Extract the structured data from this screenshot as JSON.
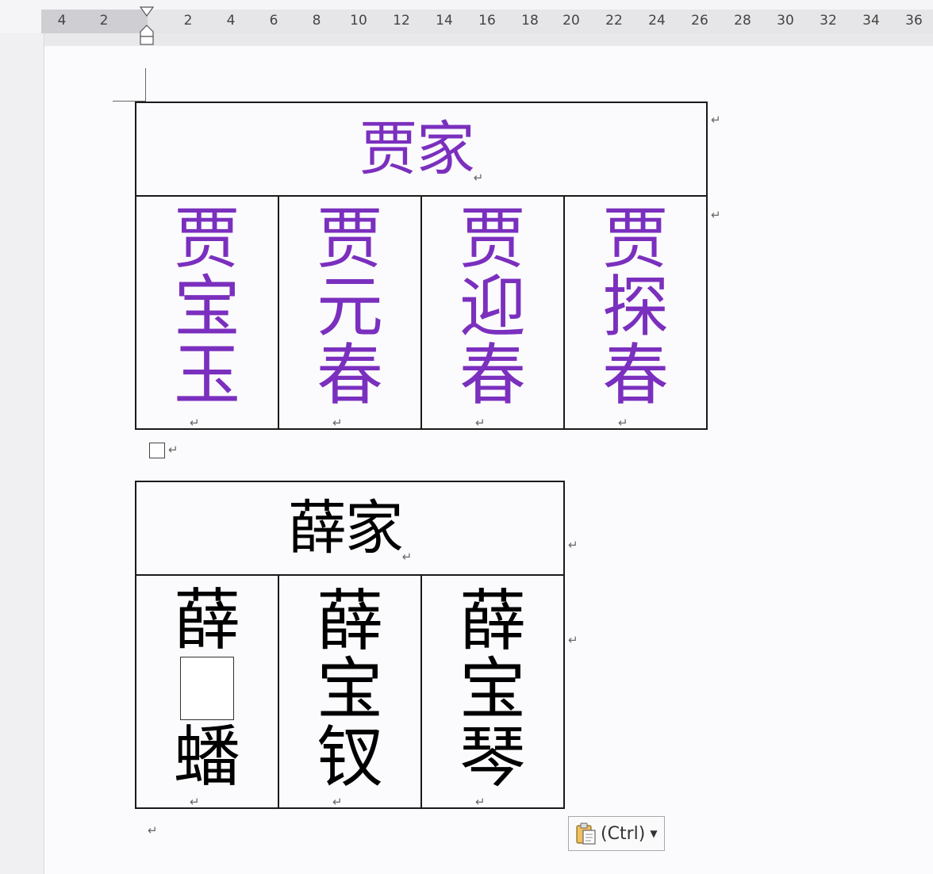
{
  "ruler": {
    "left_numbers": [
      "4",
      "2"
    ],
    "right_numbers": [
      "2",
      "4",
      "6",
      "8",
      "10",
      "12",
      "14",
      "16",
      "18",
      "20",
      "22",
      "24",
      "26",
      "28",
      "30",
      "32",
      "34",
      "36"
    ]
  },
  "colors": {
    "jia_text": "#7b2fbe",
    "xue_text": "#000000"
  },
  "paragraph_mark": "↵",
  "cell_end_mark": "↵",
  "table_jia": {
    "header": "贾家",
    "names": [
      "贾宝玉",
      "贾元春",
      "贾迎春",
      "贾探春"
    ]
  },
  "table_xue": {
    "header": "薛家",
    "names": [
      {
        "top": "薛",
        "missing": true,
        "bottom": "蟠"
      },
      {
        "text": "薛宝钗"
      },
      {
        "text": "薛宝琴"
      }
    ]
  },
  "paste_options": {
    "label": "(Ctrl)",
    "icon": "clipboard-icon"
  }
}
